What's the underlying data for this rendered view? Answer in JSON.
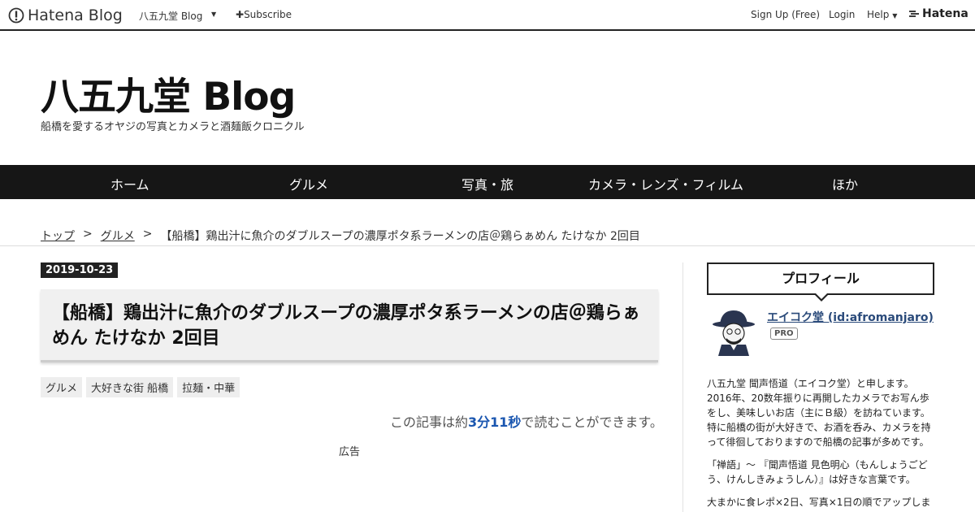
{
  "topbar": {
    "logo_text": "Hatena Blog",
    "blog_name": "八五九堂 Blog",
    "subscribe": "Subscribe",
    "signup": "Sign Up (Free)",
    "login": "Login",
    "help": "Help",
    "hatena": "Hatena"
  },
  "header": {
    "title": "八五九堂 Blog",
    "description": "船橋を愛するオヤジの写真とカメラと酒麺飯クロニクル"
  },
  "nav": {
    "items": [
      "ホーム",
      "グルメ",
      "写真・旅",
      "カメラ・レンズ・フィルム",
      "ほか"
    ]
  },
  "breadcrumb": {
    "top": "トップ",
    "sep": ">",
    "category": "グルメ",
    "current": "【船橋】鶏出汁に魚介のダブルスープの濃厚ポタ系ラーメンの店＠鶏らぁめん たけなか 2回目"
  },
  "article": {
    "date": "2019-10-23",
    "title": "【船橋】鶏出汁に魚介のダブルスープの濃厚ポタ系ラーメンの店＠鶏らぁめん たけなか 2回目",
    "tags": [
      "グルメ",
      "大好きな街 船橋",
      "拉麺・中華"
    ],
    "read_pre": "この記事は約",
    "read_time": "3分11秒",
    "read_post": "で読むことができます。",
    "ad": "広告"
  },
  "sidebar": {
    "profile_heading": "プロフィール",
    "name": "エイコク堂 (id:afromanjaro)",
    "badge": "PRO",
    "para1": "八五九堂 聞声悟道（エイコク堂）と申します。2016年、20数年振りに再開したカメラでお写ん歩をし、美味しいお店（主にＢ級）を訪ねています。特に船橋の街が大好きで、お酒を呑み、カメラを持って徘徊しておりますので船橋の記事が多めです。",
    "para2": "「禅語」～ 『聞声悟道 見色明心（もんしょうごどう、けんしきみょうしん）』は好きな言葉です。",
    "para3": "大まかに食レポ×2日、写真×1日の順でアップしま"
  }
}
